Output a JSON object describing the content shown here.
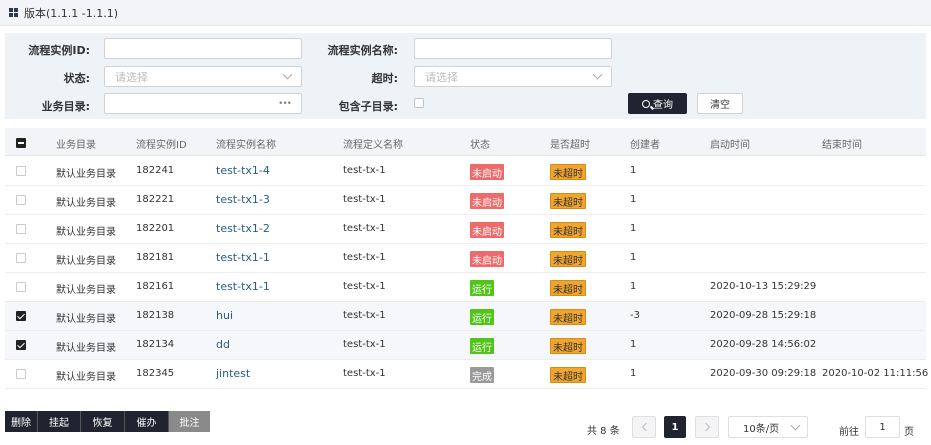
{
  "titlebar": {
    "title": "版本(1.1.1 -1.1.1)"
  },
  "filter": {
    "instance_id_label": "流程实例ID:",
    "instance_name_label": "流程实例名称:",
    "status_label": "状态:",
    "status_placeholder": "请选择",
    "timeout_label": "超时:",
    "timeout_placeholder": "请选择",
    "catalog_label": "业务目录:",
    "include_sub_label": "包含子目录:",
    "query_label": "查询",
    "clear_label": "清空"
  },
  "table": {
    "headers": [
      "业务目录",
      "流程实例ID",
      "流程实例名称",
      "流程定义名称",
      "状态",
      "是否超时",
      "创建者",
      "启动时间",
      "结束时间"
    ],
    "rows": [
      {
        "checked": false,
        "catalog": "默认业务目录",
        "id": "182241",
        "name": "test-tx1-4",
        "def": "test-tx-1",
        "status": "未启动",
        "status_type": "red",
        "timeout": "未超时",
        "creator": "1",
        "start": "",
        "end": ""
      },
      {
        "checked": false,
        "catalog": "默认业务目录",
        "id": "182221",
        "name": "test-tx1-3",
        "def": "test-tx-1",
        "status": "未启动",
        "status_type": "red",
        "timeout": "未超时",
        "creator": "1",
        "start": "",
        "end": ""
      },
      {
        "checked": false,
        "catalog": "默认业务目录",
        "id": "182201",
        "name": "test-tx1-2",
        "def": "test-tx-1",
        "status": "未启动",
        "status_type": "red",
        "timeout": "未超时",
        "creator": "1",
        "start": "",
        "end": ""
      },
      {
        "checked": false,
        "catalog": "默认业务目录",
        "id": "182181",
        "name": "test-tx1-1",
        "def": "test-tx-1",
        "status": "未启动",
        "status_type": "red",
        "timeout": "未超时",
        "creator": "1",
        "start": "",
        "end": ""
      },
      {
        "checked": false,
        "catalog": "默认业务目录",
        "id": "182161",
        "name": "test-tx1-1",
        "def": "test-tx-1",
        "status": "运行",
        "status_type": "green",
        "timeout": "未超时",
        "creator": "1",
        "start": "2020-10-13 15:29:29",
        "end": ""
      },
      {
        "checked": true,
        "catalog": "默认业务目录",
        "id": "182138",
        "name": "hui",
        "def": "test-tx-1",
        "status": "运行",
        "status_type": "green",
        "timeout": "未超时",
        "creator": "-3",
        "start": "2020-09-28 15:29:18",
        "end": ""
      },
      {
        "checked": true,
        "catalog": "默认业务目录",
        "id": "182134",
        "name": "dd",
        "def": "test-tx-1",
        "status": "运行",
        "status_type": "green",
        "timeout": "未超时",
        "creator": "1",
        "start": "2020-09-28 14:56:02",
        "end": ""
      },
      {
        "checked": false,
        "catalog": "默认业务目录",
        "id": "182345",
        "name": "jintest",
        "def": "test-tx-1",
        "status": "完成",
        "status_type": "gray",
        "timeout": "未超时",
        "creator": "1",
        "start": "2020-09-30 09:29:18",
        "end": "2020-10-02 11:11:56"
      }
    ]
  },
  "actions": {
    "delete": "删除",
    "suspend": "挂起",
    "resume": "恢复",
    "urge": "催办",
    "annotate": "批注"
  },
  "pager": {
    "total": "共 8 条",
    "current": "1",
    "page_size": "10条/页",
    "goto": "前往",
    "goto_value": "1",
    "page_unit": "页"
  },
  "colors": {
    "dark": "#1f2430",
    "red": "#ef6b6b",
    "green": "#52c41a",
    "gray": "#9a9a9a",
    "orange": "#f0a52f"
  }
}
